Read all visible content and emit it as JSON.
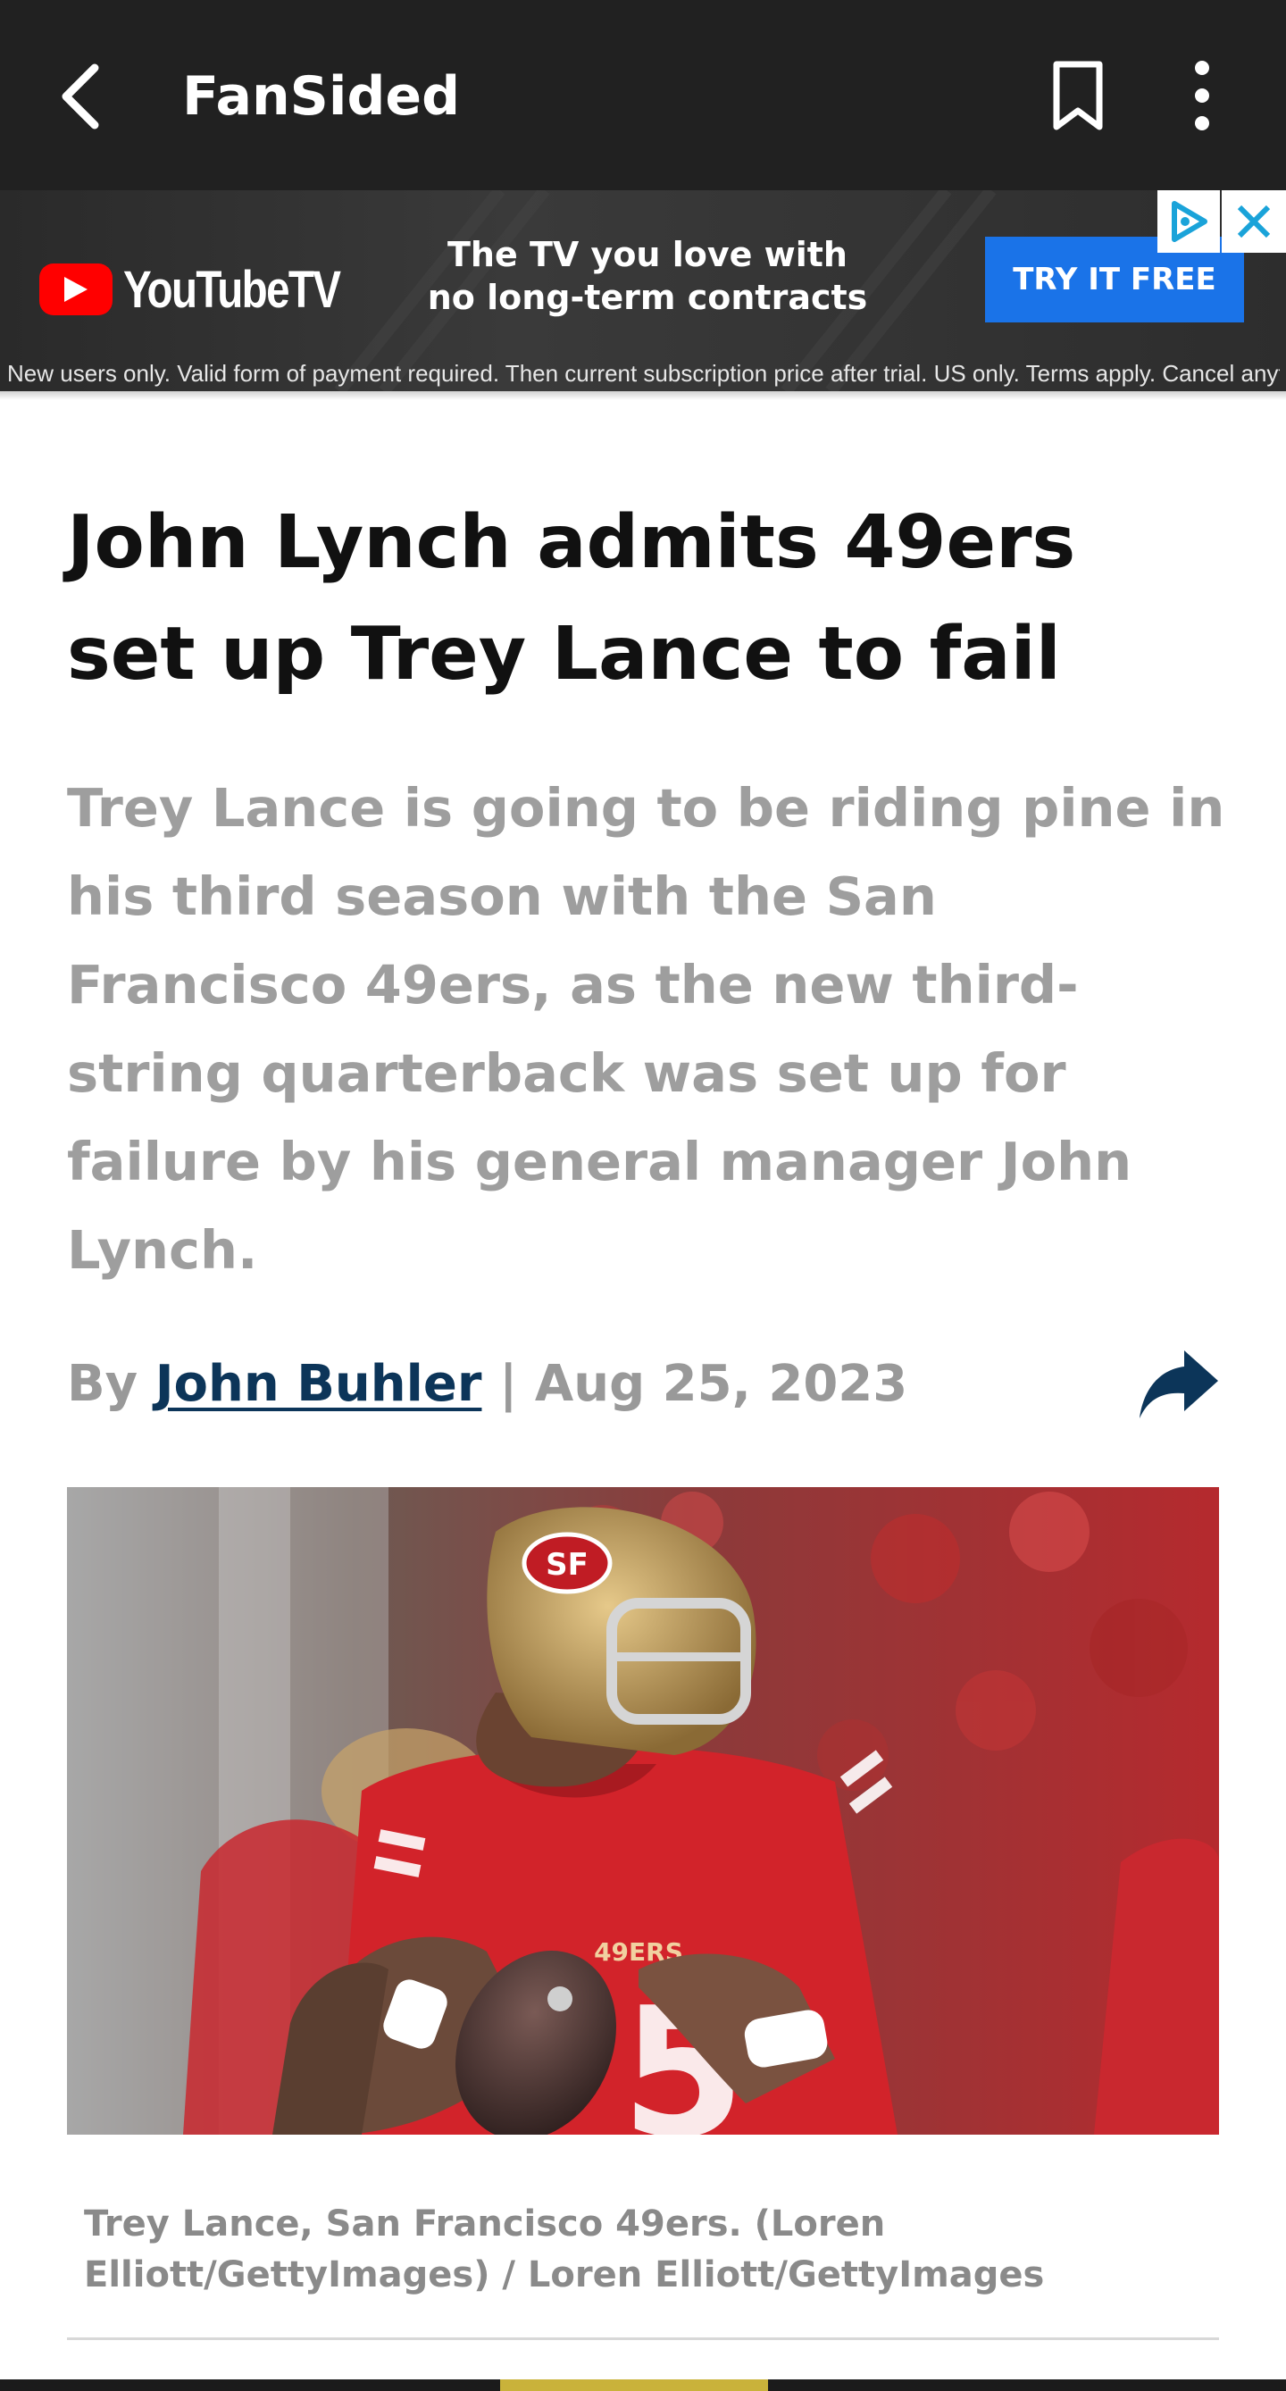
{
  "app_bar": {
    "title": "FanSided",
    "back_icon": "arrow-back-icon",
    "bookmark_icon": "bookmark-icon",
    "more_icon": "more-vertical-icon"
  },
  "ad": {
    "brand": "YouTubeTV",
    "tagline_line1": "The TV you love with",
    "tagline_line2": "no long-term contracts",
    "cta": "TRY IT FREE",
    "fine_print": "New users only. Valid form of payment required. Then current subscription price after trial. US only. Terms apply. Cancel anytime.",
    "choices_icon": "adchoices-icon",
    "close_icon": "close-icon",
    "colors": {
      "cta": "#1a73e8",
      "youtube_red": "#ff0000"
    }
  },
  "article": {
    "headline": "John Lynch admits 49ers set up Trey Lance to fail",
    "dek": "Trey Lance is going to be riding pine in his third season with the San Francisco 49ers, as the new third-string quarterback was set up for failure by his general manager John Lynch.",
    "byline_prefix": "By",
    "author": "John Buhler",
    "separator": "|",
    "date": "Aug 25, 2023",
    "share_icon": "share-icon",
    "image_caption": "Trey Lance, San Francisco 49ers. (Loren Elliott/GettyImages) / Loren Elliott/GettyImages",
    "hero_image": {
      "jersey_text": "49ERS",
      "jersey_number": "5",
      "helmet_logo": "SF"
    },
    "colors": {
      "author_link": "#0c3559",
      "headline": "#111111",
      "dek": "#9e9e9e"
    }
  }
}
